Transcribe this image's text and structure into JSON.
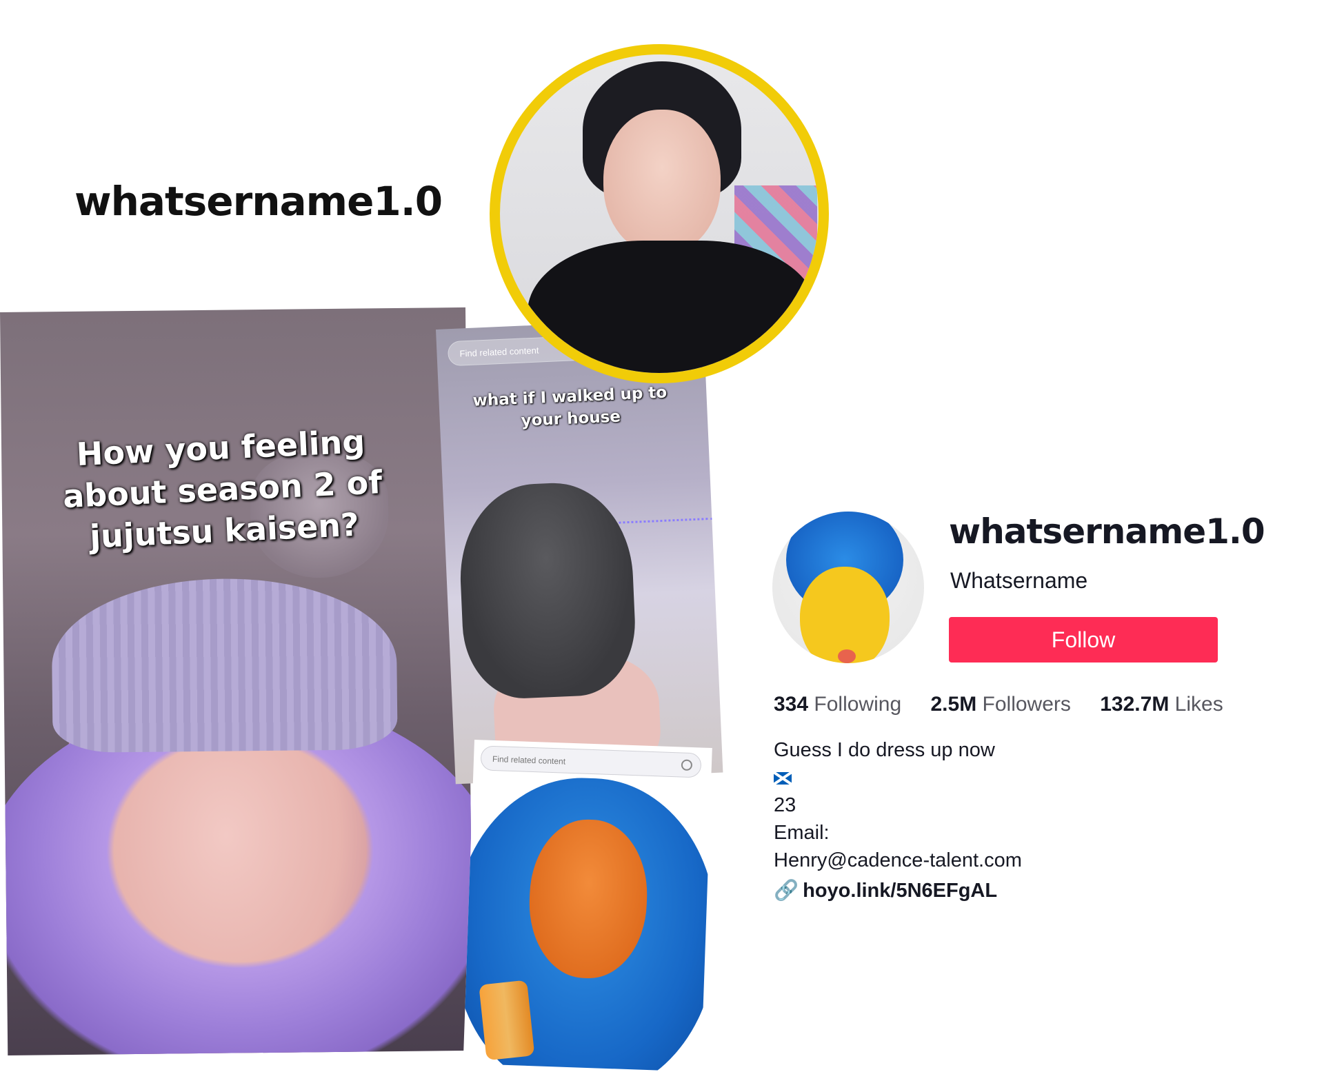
{
  "headline": "whatsername1.0",
  "videos": {
    "card1": {
      "caption": "How you feeling about season 2 of jujutsu kaisen?"
    },
    "card2": {
      "search_placeholder": "Find related content",
      "caption": "what if I walked up to your house"
    },
    "card3": {
      "search_placeholder": "Find related content"
    }
  },
  "profile": {
    "username": "whatsername1.0",
    "nickname": "Whatsername",
    "follow_label": "Follow",
    "stats": [
      {
        "value": "334",
        "label": "Following"
      },
      {
        "value": "2.5M",
        "label": "Followers"
      },
      {
        "value": "132.7M",
        "label": "Likes"
      }
    ],
    "bio": {
      "line1": "Guess I do dress up now",
      "line3": "23",
      "line4": "Email:",
      "line5": "Henry@cadence-talent.com"
    },
    "link": "hoyo.link/5N6EFgAL",
    "colors": {
      "follow": "#fe2c55",
      "avatar_ring": "#f1cc08"
    }
  }
}
